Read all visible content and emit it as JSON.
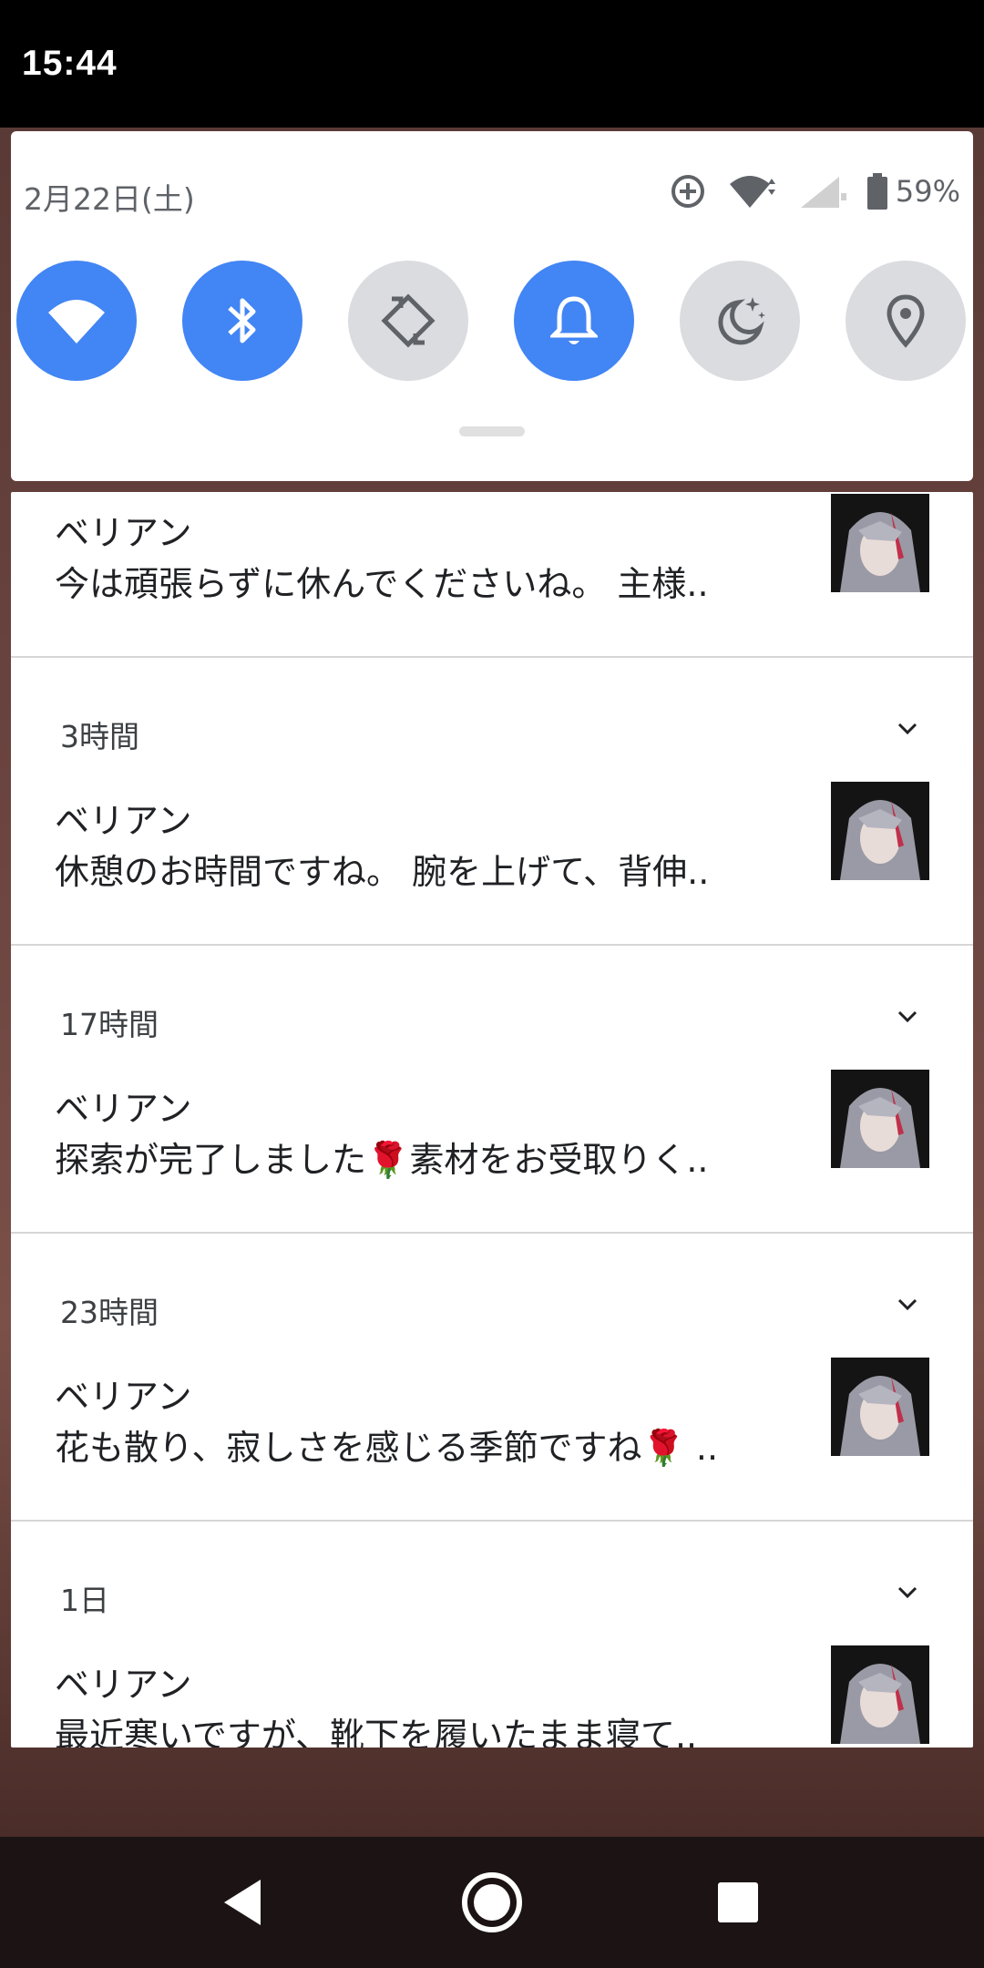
{
  "status_bar": {
    "time": "15:44"
  },
  "quick_settings": {
    "date": "2月22日(土)",
    "battery": "59%",
    "tiles": [
      {
        "name": "wifi",
        "icon": "wifi-icon",
        "state": "on"
      },
      {
        "name": "bluetooth",
        "icon": "bluetooth-icon",
        "state": "on"
      },
      {
        "name": "auto-rotate",
        "icon": "rotate-icon",
        "state": "off"
      },
      {
        "name": "sound",
        "icon": "bell-icon",
        "state": "on"
      },
      {
        "name": "night-light",
        "icon": "moon-icon",
        "state": "off"
      },
      {
        "name": "location",
        "icon": "location-pin-icon",
        "state": "off"
      }
    ]
  },
  "notifications": [
    {
      "time": "",
      "title": "ベリアン",
      "text": "今は頑張らずに休んでくださいね。 主様.."
    },
    {
      "time": "3時間",
      "title": "ベリアン",
      "text": "休憩のお時間ですね。 腕を上げて、背伸.."
    },
    {
      "time": "17時間",
      "title": "ベリアン",
      "text": "探索が完了しました🌹素材をお受取りく.."
    },
    {
      "time": "23時間",
      "title": "ベリアン",
      "text": "花も散り、寂しさを感じる季節ですね🌹 .."
    },
    {
      "time": "1日",
      "title": "ベリアン",
      "text": "最近寒いですが、靴下を履いたまま寝て.."
    }
  ],
  "colors": {
    "accent": "#4285f4",
    "tile_off": "#dadce0"
  }
}
